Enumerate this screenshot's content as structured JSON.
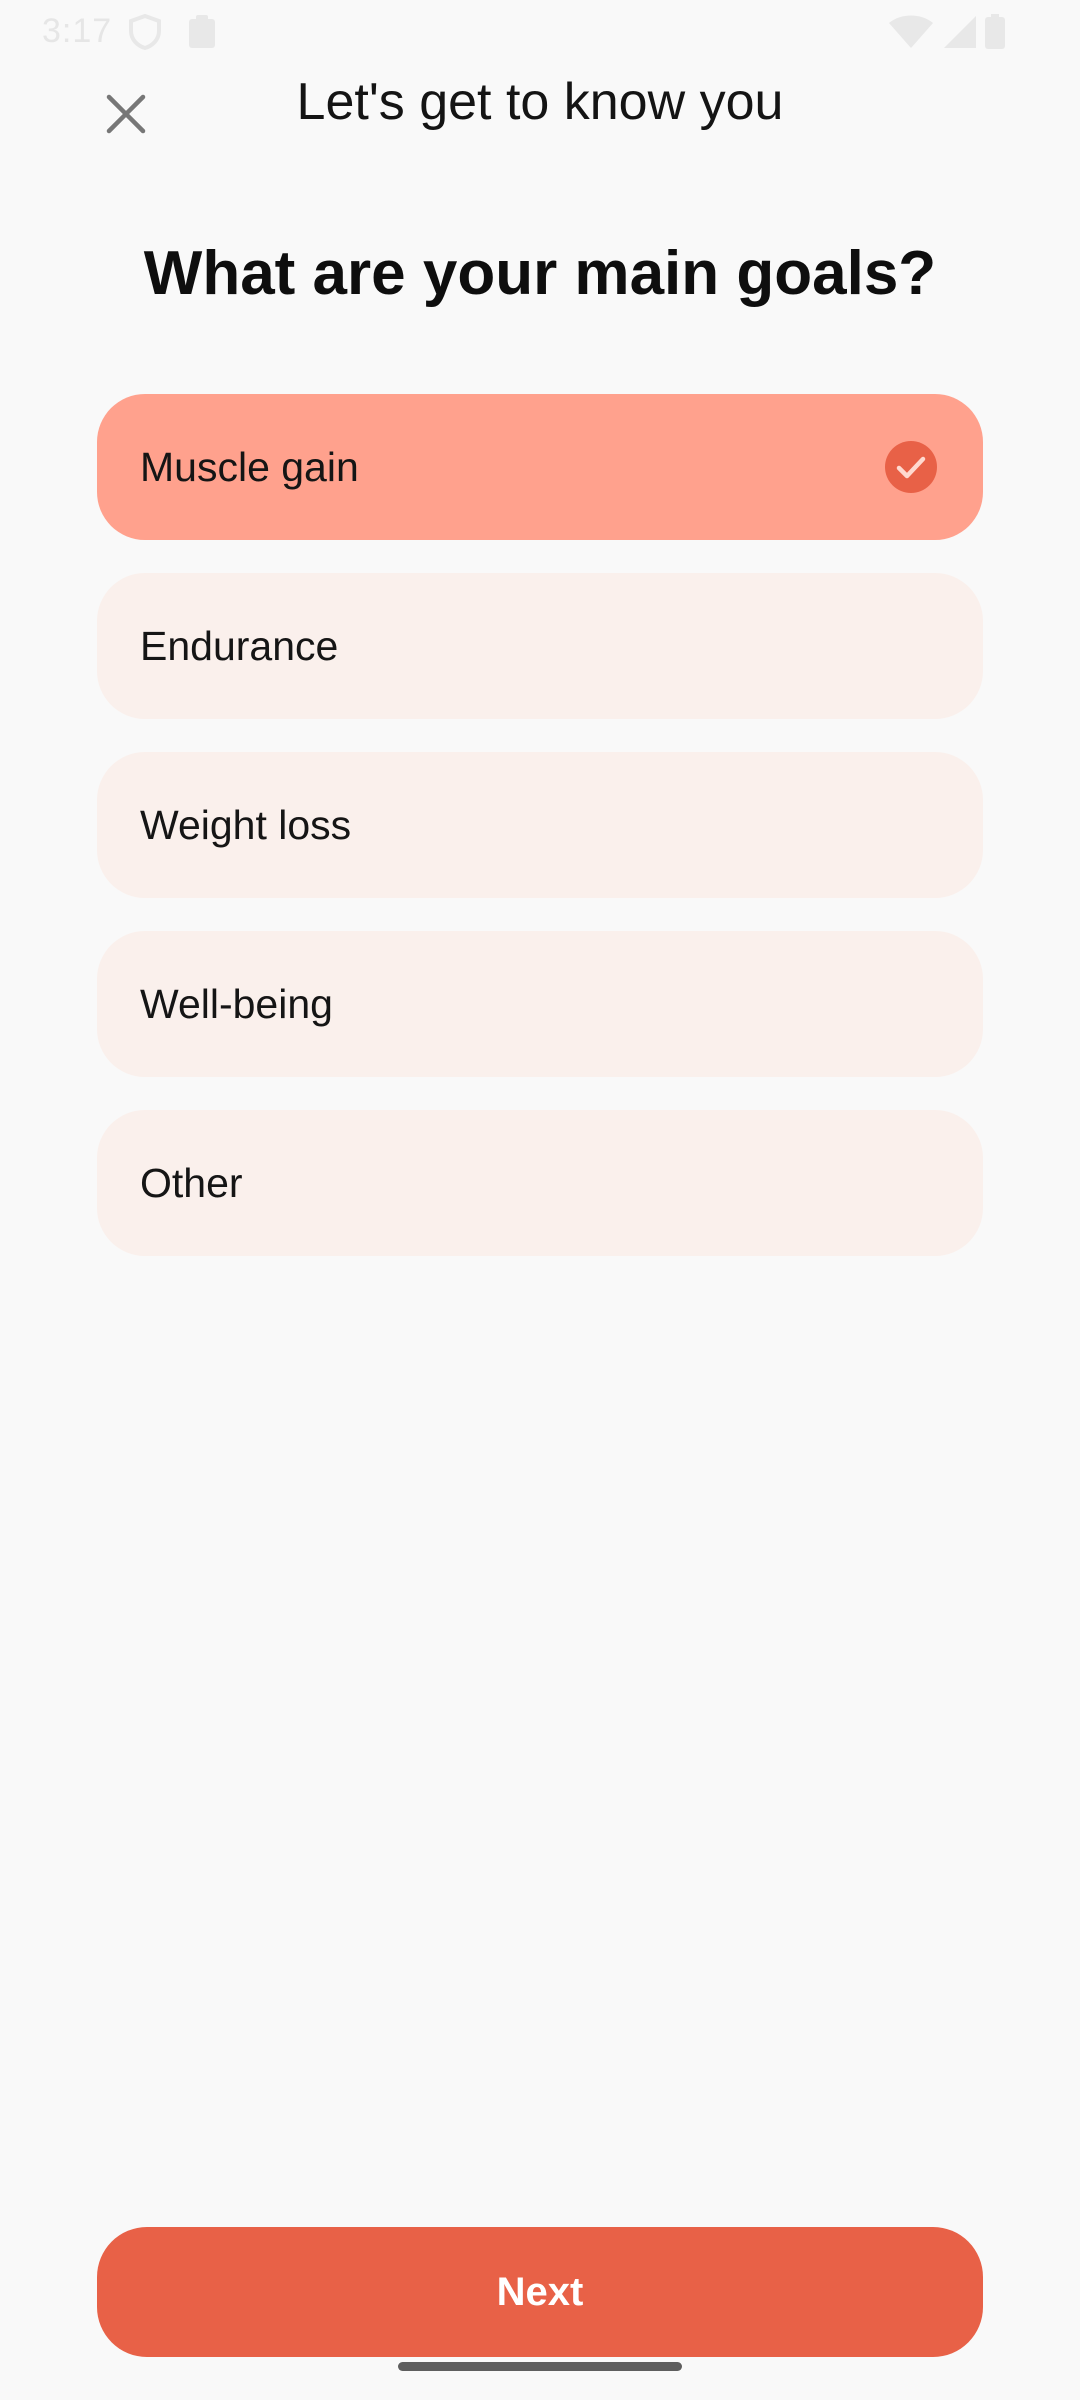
{
  "status_bar": {
    "time": "3:17",
    "icons": [
      "shield-icon",
      "clipboard-icon",
      "wifi-icon",
      "signal-icon",
      "battery-icon"
    ]
  },
  "header": {
    "title": "Let's get to know you",
    "close_icon": "close-icon"
  },
  "question": "What are your main goals?",
  "options": [
    {
      "label": "Muscle gain",
      "selected": true
    },
    {
      "label": "Endurance",
      "selected": false
    },
    {
      "label": "Weight loss",
      "selected": false
    },
    {
      "label": "Well-being",
      "selected": false
    },
    {
      "label": "Other",
      "selected": false
    }
  ],
  "next_button": {
    "label": "Next"
  },
  "colors": {
    "accent": "#e86147",
    "selected_option_bg": "#ffa18d",
    "option_bg": "#faf0ec",
    "background": "#f9f9f9"
  }
}
